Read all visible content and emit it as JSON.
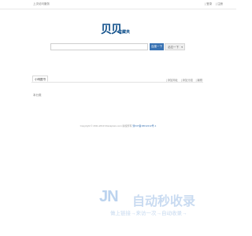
{
  "topbar": {
    "left_text": "上次访问服务",
    "login": "| 登录",
    "register": "| 注册"
  },
  "logo": {
    "mark": "贝贝",
    "sub": "收藏夹"
  },
  "search": {
    "input_value": "",
    "primary_button": "百度一下",
    "secondary_button": "必应一下",
    "secondary_caret": "▾"
  },
  "panel": {
    "tab_label": "小明图书",
    "actions": [
      "| 添加网址",
      "| 添加分组",
      "| 编辑"
    ],
    "empty_text": "本分类"
  },
  "footer": {
    "copyright": "Copyright © 2011-2013 bbscapture.com  版权所有",
    "icp": "浙ICP备18012212号-1"
  },
  "watermark": {
    "logo": "JN",
    "title": "自动秒收录",
    "tagline": "做上链接→来访一次→自动收录→"
  },
  "colors": {
    "brand": "#0f4f8a",
    "primary_button": "#3a73b3",
    "watermark": "#c9dbf1"
  }
}
